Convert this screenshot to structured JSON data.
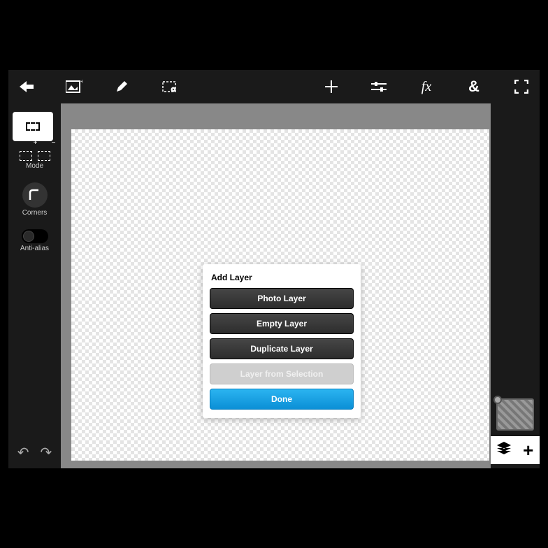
{
  "sidebar": {
    "mode_label": "Mode",
    "corners_label": "Corners",
    "antialias_label": "Anti-alias"
  },
  "dialog": {
    "title": "Add Layer",
    "buttons": {
      "photo": "Photo Layer",
      "empty": "Empty Layer",
      "duplicate": "Duplicate Layer",
      "from_selection": "Layer from Selection",
      "done": "Done"
    }
  },
  "topbar": {
    "fx_label": "fx",
    "ampersand_label": "&"
  }
}
